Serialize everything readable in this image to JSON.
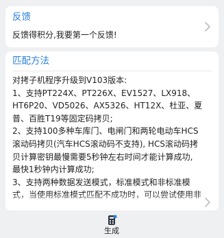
{
  "feedback": {
    "title": "反馈",
    "text": "反馈得积分,我要第一个反馈!"
  },
  "method": {
    "title": "匹配方法",
    "lines": [
      "对拷子机程序升级到V103版本:",
      "1、支持PT224X、PT226X、EV1527、LX918、",
      "HT6P20、VD5026、AX5326、HT12X、杜亚、夏",
      "普、百胜T19等固定码拷贝;",
      "2、支持100多种车库门、电闸门和两轮电动车HCS",
      "滚动码拷贝(汽车HCS滚动码不支持), HCS滚动码拷",
      "贝计算密钥最慢需要5秒钟左右时间才能计算成功,",
      "最快1秒钟内计算成功;",
      "3、支持两种数据发送模式，标准模式和非标准模",
      "式，当使用标准模式匹配不成功时，可以尝试使用非"
    ]
  },
  "bottom": {
    "generate_label": "生成"
  },
  "icons": {
    "chevron": "chevron-right-icon",
    "generate": "remote-generate-icon"
  },
  "colors": {
    "accent": "#2a82d8",
    "background": "#eef0f2",
    "card": "#ffffff",
    "text": "#222222"
  }
}
